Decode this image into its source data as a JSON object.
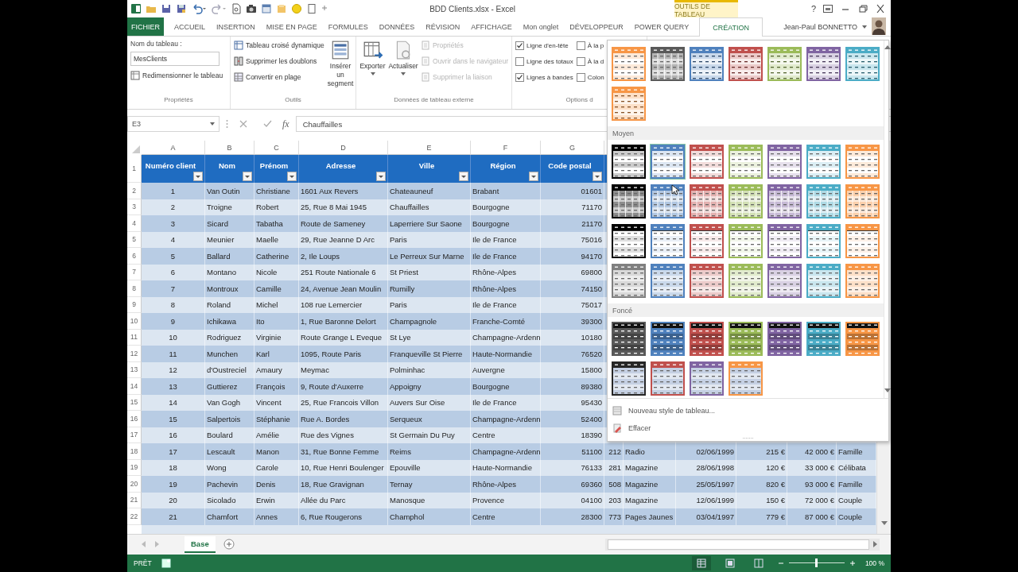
{
  "title_bar": {
    "title": "BDD Clients.xlsx - Excel",
    "context_label": "OUTILS DE TABLEAU",
    "help": "?"
  },
  "tabs": [
    {
      "label": "FICHIER",
      "kind": "file",
      "selected": false
    },
    {
      "label": "ACCUEIL",
      "kind": "tab",
      "selected": false
    },
    {
      "label": "INSERTION",
      "kind": "tab",
      "selected": false
    },
    {
      "label": "MISE EN PAGE",
      "kind": "tab",
      "selected": false
    },
    {
      "label": "FORMULES",
      "kind": "tab",
      "selected": false
    },
    {
      "label": "DONNÉES",
      "kind": "tab",
      "selected": false
    },
    {
      "label": "RÉVISION",
      "kind": "tab",
      "selected": false
    },
    {
      "label": "AFFICHAGE",
      "kind": "tab",
      "selected": false
    },
    {
      "label": "Mon onglet",
      "kind": "tab",
      "selected": false
    },
    {
      "label": "DÉVELOPPEUR",
      "kind": "tab",
      "selected": false
    },
    {
      "label": "POWER QUERY",
      "kind": "tab",
      "selected": false
    },
    {
      "label": "CRÉATION",
      "kind": "context",
      "selected": true
    }
  ],
  "user": {
    "name": "Jean-Paul BONNETTO"
  },
  "ribbon": {
    "properties": {
      "label": "Nom du tableau :",
      "table_name": "MesClients",
      "resize": "Redimensionner le tableau",
      "group": "Propriétés"
    },
    "tools": {
      "items": [
        "Tableau croisé dynamique",
        "Supprimer les doublons",
        "Convertir en plage"
      ],
      "slicer": "Insérer un segment",
      "group": "Outils"
    },
    "external": {
      "export": "Exporter",
      "refresh": "Actualiser",
      "items": [
        {
          "label": "Propriétés",
          "disabled": true
        },
        {
          "label": "Ouvrir dans le navigateur",
          "disabled": true
        },
        {
          "label": "Supprimer la liaison",
          "disabled": true
        }
      ],
      "group": "Données de tableau externe"
    },
    "style_options": {
      "columns": [
        [
          {
            "label": "Ligne d'en-tête",
            "checked": true
          },
          {
            "label": "Ligne des totaux",
            "checked": false
          },
          {
            "label": "Lignes à bandes",
            "checked": true
          }
        ],
        [
          {
            "label": "À la p",
            "checked": false
          },
          {
            "label": "À la d",
            "checked": false
          },
          {
            "label": "Colon",
            "checked": false
          }
        ]
      ],
      "group": "Options d"
    }
  },
  "formula_bar": {
    "name_box": "E3",
    "fx": "fx",
    "formula": "Chauffailles"
  },
  "sheet": {
    "column_letters": [
      "A",
      "B",
      "C",
      "D",
      "E",
      "F",
      "G"
    ],
    "header": {
      "number": "1",
      "cells": [
        "Numéro client",
        "Nom",
        "Prénom",
        "Adresse",
        "Ville",
        "Région",
        "Code postal"
      ]
    },
    "rows": [
      {
        "number": "2",
        "cells": [
          "1",
          "Van Outin",
          "Christiane",
          "1601 Aux Revers",
          "Chateauneuf",
          "Brabant",
          "01601"
        ]
      },
      {
        "number": "3",
        "cells": [
          "2",
          "Troigne",
          "Robert",
          "25, Rue 8 Mai 1945",
          "Chauffailles",
          "Bourgogne",
          "71170"
        ]
      },
      {
        "number": "4",
        "cells": [
          "3",
          "Sicard",
          "Tabatha",
          "Route de Sameney",
          "Laperriere Sur Saone",
          "Bourgogne",
          "21170"
        ]
      },
      {
        "number": "5",
        "cells": [
          "4",
          "Meunier",
          "Maelle",
          "29, Rue Jeanne D Arc",
          "Paris",
          "Ile de France",
          "75016"
        ]
      },
      {
        "number": "6",
        "cells": [
          "5",
          "Ballard",
          "Catherine",
          "2, Ile Loups",
          "Le Perreux Sur Marne",
          "Ile de France",
          "94170"
        ]
      },
      {
        "number": "7",
        "cells": [
          "6",
          "Montano",
          "Nicole",
          "251 Route Nationale 6",
          "St Priest",
          "Rhône-Alpes",
          "69800"
        ]
      },
      {
        "number": "8",
        "cells": [
          "7",
          "Montroux",
          "Camille",
          "24, Avenue Jean Moulin",
          "Rumilly",
          "Rhône-Alpes",
          "74150"
        ]
      },
      {
        "number": "9",
        "cells": [
          "8",
          "Roland",
          "Michel",
          "108 rue Lemercier",
          "Paris",
          "Ile de France",
          "75017"
        ]
      },
      {
        "number": "10",
        "cells": [
          "9",
          "Ichikawa",
          "Ito",
          "1, Rue Baronne Delort",
          "Champagnole",
          "Franche-Comté",
          "39300"
        ]
      },
      {
        "number": "11",
        "cells": [
          "10",
          "Rodriguez",
          "Virginie",
          "Route Grange L Eveque",
          "St Lye",
          "Champagne-Ardenn",
          "10180"
        ]
      },
      {
        "number": "12",
        "cells": [
          "11",
          "Munchen",
          "Karl",
          "1095, Route Paris",
          "Franqueville St Pierre",
          "Haute-Normandie",
          "76520"
        ]
      },
      {
        "number": "13",
        "cells": [
          "12",
          "d'Oustreciel",
          "Amaury",
          "Meymac",
          "Polminhac",
          "Auvergne",
          "15800"
        ]
      },
      {
        "number": "14",
        "cells": [
          "13",
          "Guttierez",
          "François",
          "9, Route d'Auxerre",
          "Appoigny",
          "Bourgogne",
          "89380"
        ]
      },
      {
        "number": "15",
        "cells": [
          "14",
          "Van Gogh",
          "Vincent",
          "25, Rue Francois Villon",
          "Auvers Sur Oise",
          "Ile de France",
          "95430"
        ]
      },
      {
        "number": "16",
        "cells": [
          "15",
          "Salpertois",
          "Stéphanie",
          "Rue A. Bordes",
          "Serqueux",
          "Champagne-Ardenn",
          "52400"
        ]
      },
      {
        "number": "17",
        "cells": [
          "16",
          "Boulard",
          "Amélie",
          "Rue des Vignes",
          "St Germain Du Puy",
          "Centre",
          "18390"
        ]
      },
      {
        "number": "18",
        "cells": [
          "17",
          "Lescault",
          "Manon",
          "31, Rue Bonne Femme",
          "Reims",
          "Champagne-Ardenn",
          "51100",
          "212",
          "Radio",
          "02/06/1999",
          "215 €",
          "42 000 €",
          "Famille"
        ]
      },
      {
        "number": "19",
        "cells": [
          "18",
          "Wong",
          "Carole",
          "10, Rue Henri Boulenger",
          "Epouville",
          "Haute-Normandie",
          "76133",
          "281",
          "Magazine",
          "28/06/1998",
          "120 €",
          "33 000 €",
          "Célibata"
        ]
      },
      {
        "number": "20",
        "cells": [
          "19",
          "Pachevin",
          "Denis",
          "18, Rue Gravignan",
          "Ternay",
          "Rhône-Alpes",
          "69360",
          "508",
          "Magazine",
          "25/05/1997",
          "820 €",
          "93 000 €",
          "Famille"
        ]
      },
      {
        "number": "21",
        "cells": [
          "20",
          "Sicolado",
          "Erwin",
          "Allée du Parc",
          "Manosque",
          "Provence",
          "04100",
          "203",
          "Magazine",
          "12/06/1999",
          "150 €",
          "72 000 €",
          "Couple"
        ]
      },
      {
        "number": "22",
        "cells": [
          "21",
          "Chamfort",
          "Annes",
          "6, Rue Rougerons",
          "Champhol",
          "Centre",
          "28300",
          "773",
          "Pages Jaunes",
          "03/04/1997",
          "779 €",
          "87 000 €",
          "Couple"
        ]
      }
    ]
  },
  "style_gallery": {
    "sections": [
      {
        "swatches": [
          {
            "kind": "header",
            "color": "#f79646",
            "selected": false
          },
          {
            "kind": "grid",
            "color": "#595959",
            "selected": false
          },
          {
            "kind": "banded",
            "color": "#4f81bd",
            "selected": false
          },
          {
            "kind": "banded",
            "color": "#c0504d",
            "selected": false
          },
          {
            "kind": "banded",
            "color": "#9bbb59",
            "selected": false
          },
          {
            "kind": "banded",
            "color": "#8064a2",
            "selected": false
          },
          {
            "kind": "banded",
            "color": "#4bacc6",
            "selected": false
          },
          {
            "kind": "banded",
            "color": "#f79646",
            "selected": false
          }
        ]
      },
      {
        "label": "Moyen",
        "swatches": [
          {
            "kind": "header",
            "color": "#000000",
            "selected": false
          },
          {
            "kind": "header",
            "color": "#4f81bd",
            "selected": true
          },
          {
            "kind": "header",
            "color": "#c0504d",
            "selected": false
          },
          {
            "kind": "header",
            "color": "#9bbb59",
            "selected": false
          },
          {
            "kind": "header",
            "color": "#8064a2",
            "selected": false
          },
          {
            "kind": "header",
            "color": "#4bacc6",
            "selected": false
          },
          {
            "kind": "header",
            "color": "#f79646",
            "selected": false
          },
          {
            "kind": "grid",
            "color": "#000000",
            "selected": false
          },
          {
            "kind": "grid",
            "color": "#4f81bd",
            "selected": false
          },
          {
            "kind": "grid",
            "color": "#c0504d",
            "selected": false
          },
          {
            "kind": "grid",
            "color": "#9bbb59",
            "selected": false
          },
          {
            "kind": "grid",
            "color": "#8064a2",
            "selected": false
          },
          {
            "kind": "grid",
            "color": "#4bacc6",
            "selected": false
          },
          {
            "kind": "grid",
            "color": "#f79646",
            "selected": false
          },
          {
            "kind": "lined",
            "color": "#000000",
            "selected": false
          },
          {
            "kind": "lined",
            "color": "#4f81bd",
            "selected": false
          },
          {
            "kind": "lined",
            "color": "#c0504d",
            "selected": false
          },
          {
            "kind": "lined",
            "color": "#9bbb59",
            "selected": false
          },
          {
            "kind": "lined",
            "color": "#8064a2",
            "selected": false
          },
          {
            "kind": "lined",
            "color": "#4bacc6",
            "selected": false
          },
          {
            "kind": "lined",
            "color": "#f79646",
            "selected": false
          },
          {
            "kind": "tinted",
            "color": "#7f7f7f",
            "selected": false
          },
          {
            "kind": "tinted",
            "color": "#4f81bd",
            "selected": false
          },
          {
            "kind": "tinted",
            "color": "#c0504d",
            "selected": false
          },
          {
            "kind": "tinted",
            "color": "#9bbb59",
            "selected": false
          },
          {
            "kind": "tinted",
            "color": "#8064a2",
            "selected": false
          },
          {
            "kind": "tinted",
            "color": "#4bacc6",
            "selected": false
          },
          {
            "kind": "tinted",
            "color": "#f79646",
            "selected": false
          }
        ]
      },
      {
        "label": "Foncé",
        "swatches": [
          {
            "kind": "dark",
            "color": "#595959",
            "selected": false
          },
          {
            "kind": "dark",
            "color": "#4f81bd",
            "selected": false
          },
          {
            "kind": "dark",
            "color": "#c0504d",
            "selected": false
          },
          {
            "kind": "dark",
            "color": "#9bbb59",
            "selected": false
          },
          {
            "kind": "dark",
            "color": "#8064a2",
            "selected": false
          },
          {
            "kind": "dark",
            "color": "#4bacc6",
            "selected": false
          },
          {
            "kind": "dark",
            "color": "#f79646",
            "selected": false
          },
          {
            "kind": "pair",
            "color": "#262626",
            "selected": false
          },
          {
            "kind": "pair",
            "color": "#c0504d",
            "selected": false
          },
          {
            "kind": "pair",
            "color": "#8064a2",
            "selected": false
          },
          {
            "kind": "pair",
            "color": "#f79646",
            "selected": false
          }
        ]
      }
    ],
    "menu": [
      {
        "kind": "new",
        "label": "Nouveau style de tableau..."
      },
      {
        "kind": "clear",
        "label": "Effacer"
      }
    ]
  },
  "sheet_tabs": [
    {
      "label": "Base",
      "selected": true
    }
  ],
  "status_bar": {
    "status": "PRÊT",
    "zoom": "100 %",
    "zoom_slider": {
      "level": 0.5
    }
  }
}
